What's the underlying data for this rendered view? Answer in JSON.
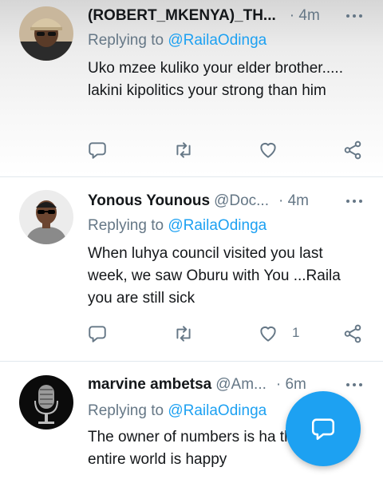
{
  "tweets": [
    {
      "name": "(ROBERT_MKENYA)_TH...",
      "handle": "",
      "time": "· 4m",
      "replying_prefix": "Replying to",
      "replying_to": "@RailaOdinga",
      "text": "Uko mzee kuliko your elder brother..... lakini kipolitics your strong than him",
      "like_count": "",
      "avatar_icon": "person-cap-avatar-icon"
    },
    {
      "name": "Yonous Younous",
      "handle": "@Doc...",
      "time": "· 4m",
      "replying_prefix": "Replying to",
      "replying_to": "@RailaOdinga",
      "text": "When luhya council visited you last week, we saw Oburu with You ...Raila you are still sick",
      "like_count": "1",
      "avatar_icon": "person-sunglasses-avatar-icon"
    },
    {
      "name": "marvine ambetsa",
      "handle": "@Am...",
      "time": "· 6m",
      "replying_prefix": "Replying to",
      "replying_to": "@RailaOdinga",
      "text": "The owner of numbers is ha the entire world is happy",
      "like_count": "",
      "avatar_icon": "microphone-avatar-icon"
    }
  ],
  "colors": {
    "accent": "#1da1f2",
    "secondary_text": "#657786",
    "primary_text": "#14171a"
  },
  "fab": {
    "icon": "compose-reply-icon"
  }
}
